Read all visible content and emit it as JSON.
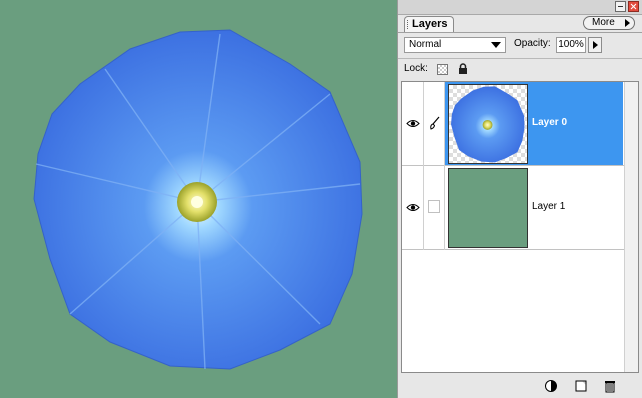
{
  "window": {
    "canvas_background": "#6a9e7f"
  },
  "layers_panel": {
    "tab_label": "Layers",
    "more_button": "More",
    "blend_mode": "Normal",
    "opacity_label": "Opacity:",
    "opacity_value": "100%",
    "lock_label": "Lock:",
    "layers": [
      {
        "name": "Layer 0",
        "selected": true,
        "visible": true
      },
      {
        "name": "Layer 1",
        "selected": false,
        "visible": true
      }
    ],
    "selection_color": "#3d96f0",
    "bottom_icons": [
      "new-fill-adjustment-icon",
      "new-layer-icon",
      "trash-icon"
    ]
  }
}
